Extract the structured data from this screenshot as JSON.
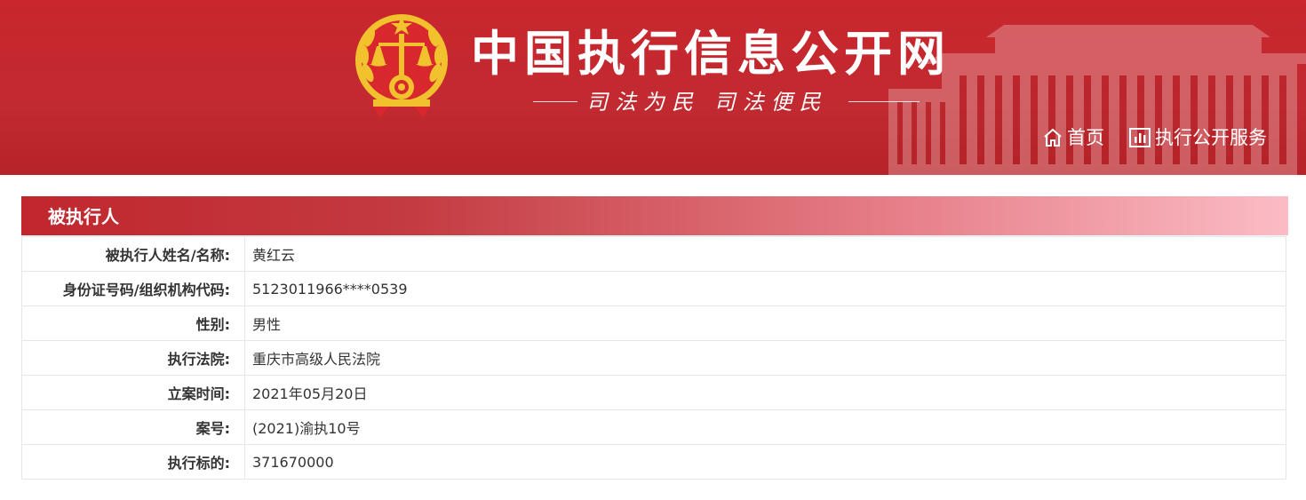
{
  "header": {
    "site_title": "中国执行信息公开网",
    "slogan": "司法为民  司法便民",
    "nav": [
      {
        "label": "首页",
        "icon": "home-icon"
      },
      {
        "label": "执行公开服务",
        "icon": "bar-chart-icon"
      }
    ]
  },
  "section": {
    "title": "被执行人"
  },
  "rows": [
    {
      "label": "被执行人姓名/名称:",
      "value": "黄红云"
    },
    {
      "label": "身份证号码/组织机构代码:",
      "value": "5123011966****0539"
    },
    {
      "label": "性别:",
      "value": "男性"
    },
    {
      "label": "执行法院:",
      "value": "重庆市高级人民法院"
    },
    {
      "label": "立案时间:",
      "value": "2021年05月20日"
    },
    {
      "label": "案号:",
      "value": "(2021)渝执10号"
    },
    {
      "label": "执行标的:",
      "value": "371670000"
    }
  ],
  "colors": {
    "header_red": "#c9262d",
    "emblem_gold": "#f2c12e",
    "border": "#e6e6e6"
  }
}
